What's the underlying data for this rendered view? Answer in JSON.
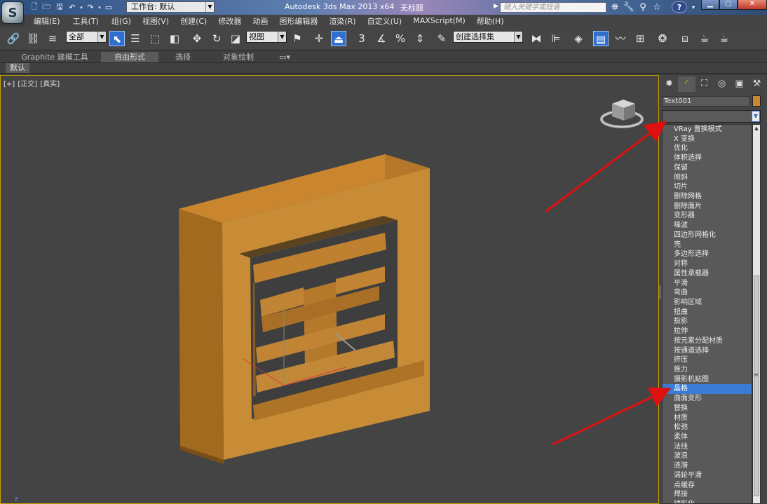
{
  "titlebar": {
    "workspace_label": "工作台: 默认",
    "app_title": "Autodesk 3ds Max  2013 x64",
    "doc_title": "无标题",
    "search_placeholder": "键入关键字或短语",
    "help_label": "?"
  },
  "app_logo": "S",
  "menus": [
    "编辑(E)",
    "工具(T)",
    "组(G)",
    "视图(V)",
    "创建(C)",
    "修改器",
    "动画",
    "图形编辑器",
    "渲染(R)",
    "自定义(U)",
    "MAXScript(M)",
    "帮助(H)"
  ],
  "toolbar": {
    "selection_filter": "全部",
    "reference_coord": "视图",
    "named_selection": "创建选择集",
    "snap_3": "3",
    "snap_percent": "%"
  },
  "ribbon": {
    "tabs": [
      "Graphite 建模工具",
      "自由形式",
      "选择",
      "对象绘制"
    ],
    "active_tab": "自由形式",
    "subtab": "默认"
  },
  "viewport": {
    "labels": [
      "[+]",
      "[正交]",
      "[真实]"
    ],
    "axis_label": "z",
    "object_color": "#c9862e"
  },
  "command_panel": {
    "object_name": "Text001",
    "object_color": "#c9862e",
    "modifier_list_value": "",
    "modifiers": [
      "VRay 置换模式",
      "X 变换",
      "优化",
      "体积选择",
      "保留",
      "倾斜",
      "切片",
      "删除网格",
      "删除面片",
      "变形器",
      "噪波",
      "四边形网格化",
      "壳",
      "多边形选择",
      "对称",
      "属性承载器",
      "平滑",
      "弯曲",
      "影响区域",
      "扭曲",
      "投影",
      "拉伸",
      "按元素分配材质",
      "按通道选择",
      "挤压",
      "推力",
      "摄影机贴图",
      "晶格",
      "曲面变形",
      "替换",
      "材质",
      "松弛",
      "柔体",
      "法线",
      "波浪",
      "涟漪",
      "涡轮平滑",
      "点缓存",
      "焊接",
      "球形化"
    ],
    "selected_modifier": "晶格"
  },
  "colors": {
    "accent_blue": "#3a7bd5",
    "arrow_red": "#e01010",
    "viewport_border": "#c8a200"
  }
}
